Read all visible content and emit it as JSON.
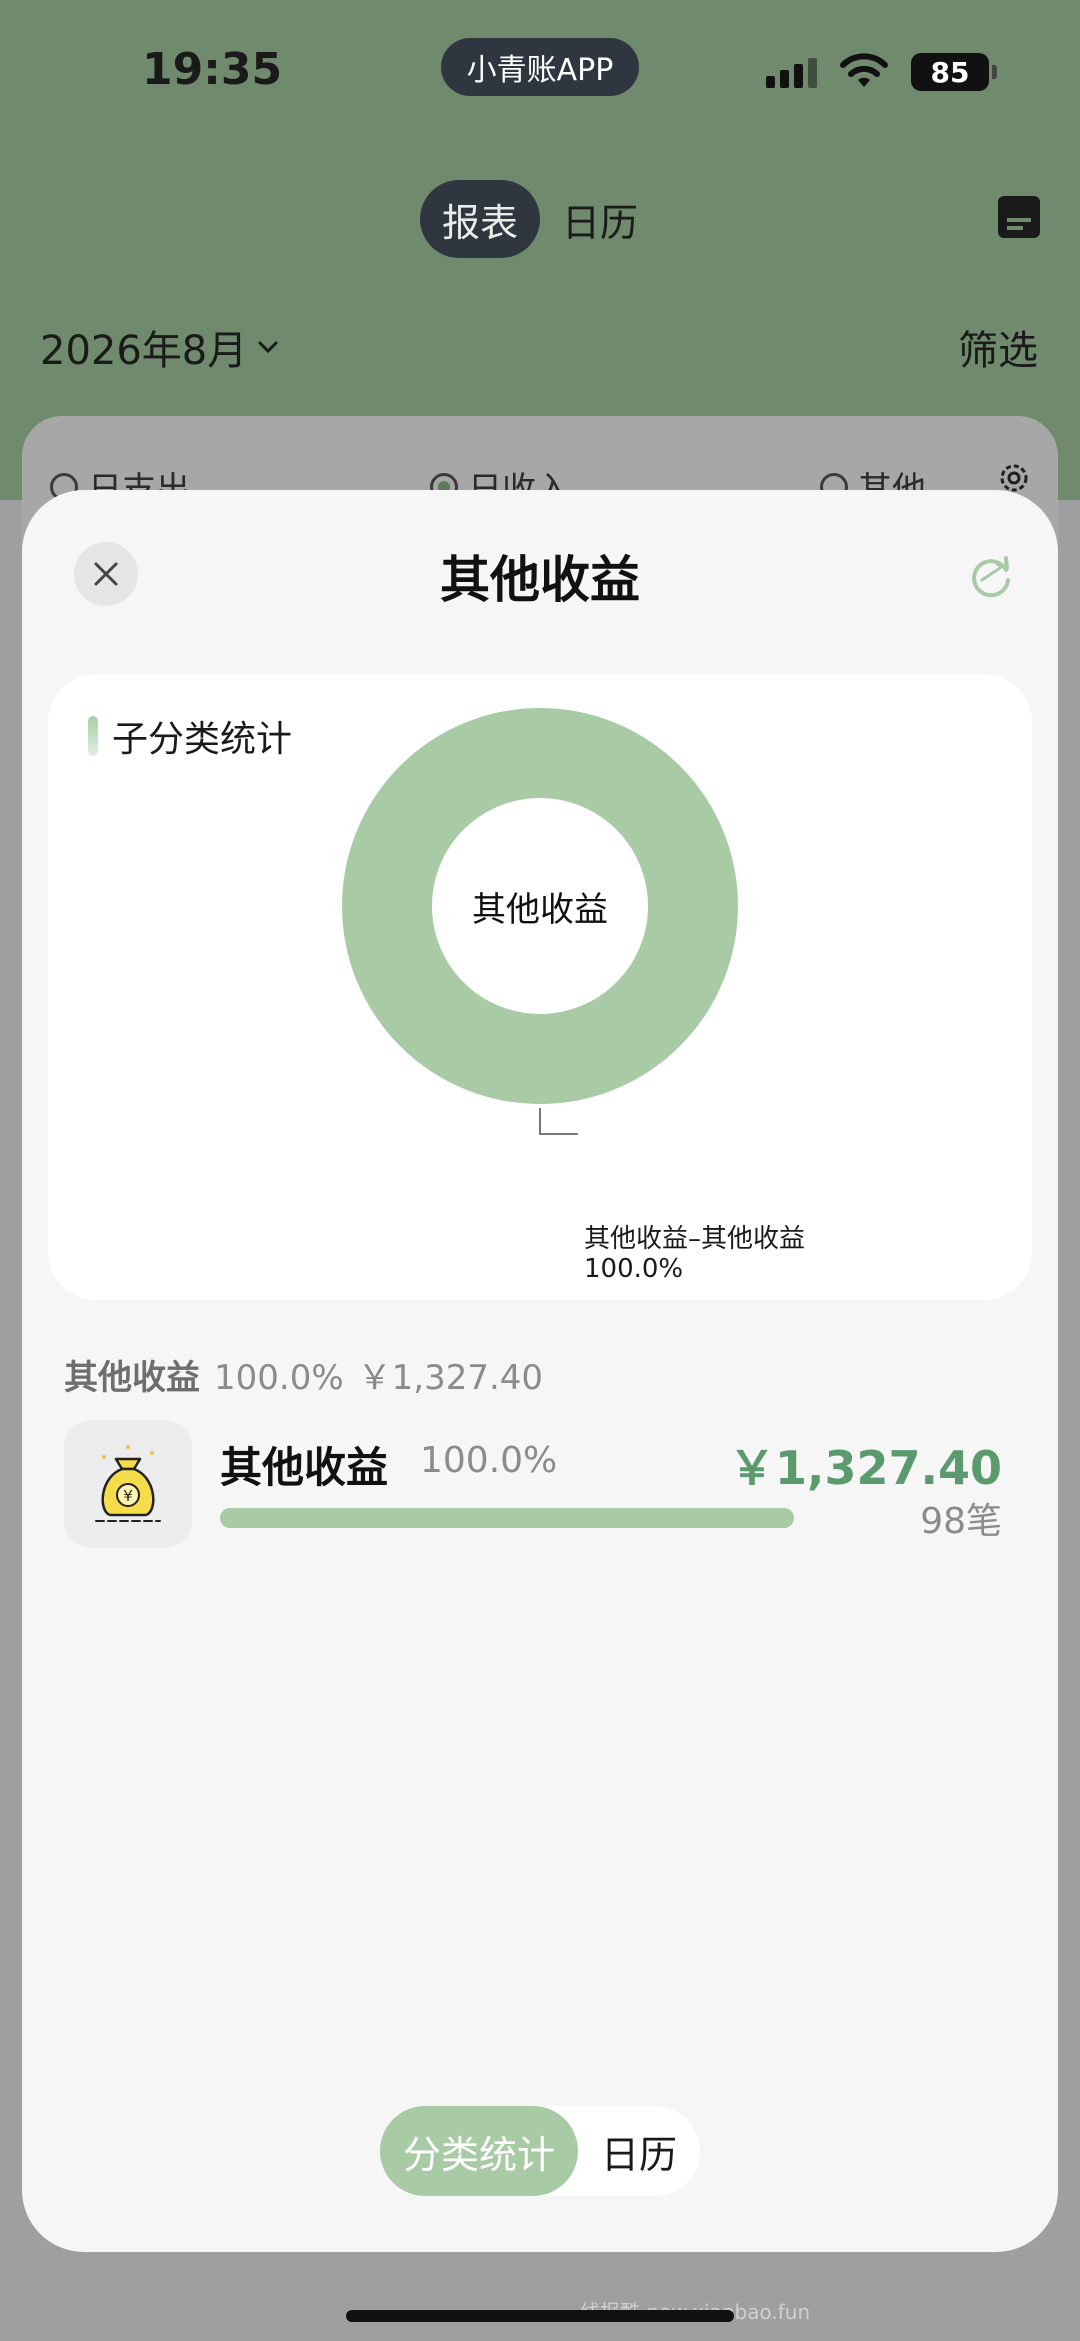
{
  "status": {
    "time": "19:35",
    "app_pill": "小青账APP",
    "battery": "85"
  },
  "header": {
    "tabs": [
      {
        "label": "报表",
        "active": true
      },
      {
        "label": "日历",
        "active": false
      }
    ],
    "month": "2026年8月",
    "filter_label": "筛选"
  },
  "type_radios": [
    {
      "label": "日支出",
      "selected": false
    },
    {
      "label": "日收入",
      "selected": true
    },
    {
      "label": "其他",
      "selected": false
    }
  ],
  "sheet": {
    "title": "其他收益",
    "card_title": "子分类统计",
    "donut_center": "其他收益",
    "slice_label": "其他收益–其他收益",
    "slice_pct": "100.0%"
  },
  "chart_data": {
    "type": "pie",
    "categories": [
      "其他收益–其他收益"
    ],
    "values": [
      100.0
    ],
    "color": "#a8cba6"
  },
  "summary": {
    "name": "其他收益",
    "pct": "100.0%",
    "amount": "￥1,327.40"
  },
  "category": {
    "name": "其他收益",
    "pct": "100.0%",
    "amount": "￥1,327.40",
    "count": "98笔",
    "progress": 1.0,
    "icon": "money-bag-icon"
  },
  "bottom_tabs": [
    {
      "label": "分类统计",
      "active": true
    },
    {
      "label": "日历",
      "active": false
    }
  ],
  "watermark": "线报酷 new.xianbao.fun",
  "colors": {
    "header_bg": "#6f8a6c",
    "accent_green": "#a8cba6",
    "amount_green": "#5a9a6d",
    "pill_dark": "#2f3640"
  }
}
